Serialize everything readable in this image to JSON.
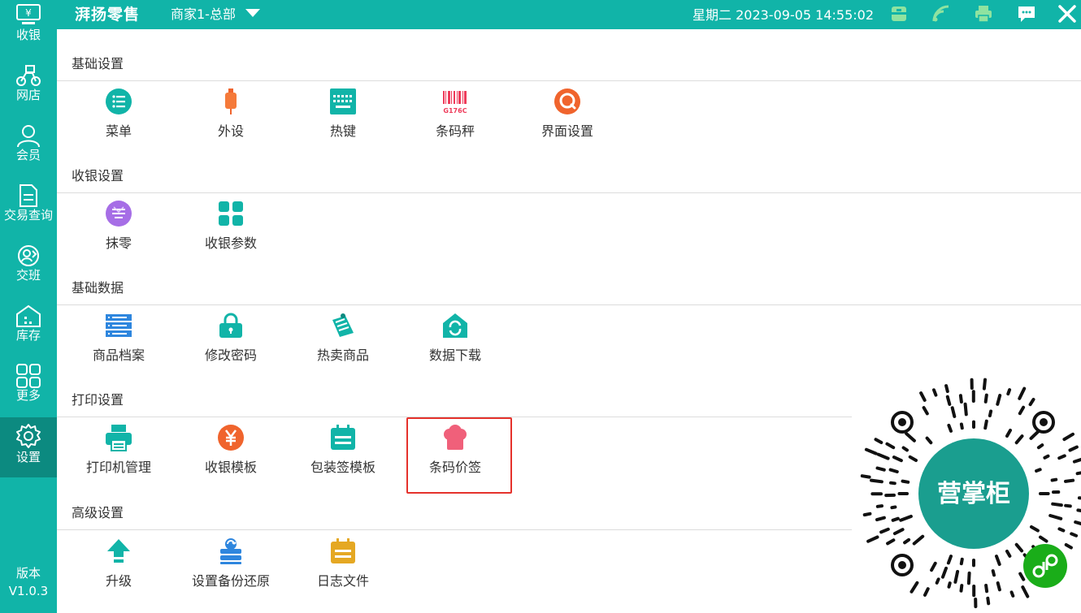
{
  "header": {
    "brand": "湃扬零售",
    "store": "商家1-总部",
    "datetime": "星期二 2023-09-05 14:55:02"
  },
  "sidebar": {
    "items": [
      {
        "label": "收银",
        "icon": "cash-register-icon"
      },
      {
        "label": "网店",
        "icon": "delivery-bike-icon"
      },
      {
        "label": "会员",
        "icon": "member-icon"
      },
      {
        "label": "交易查询",
        "icon": "document-icon"
      },
      {
        "label": "交班",
        "icon": "shift-handover-icon"
      },
      {
        "label": "库存",
        "icon": "warehouse-icon"
      },
      {
        "label": "更多",
        "icon": "grid-more-icon"
      },
      {
        "label": "设置",
        "icon": "gear-icon",
        "active": true
      }
    ],
    "version_label": "版本",
    "version": "V1.0.3"
  },
  "sections": [
    {
      "title": "基础设置",
      "items": [
        {
          "label": "菜单",
          "icon": "menu-list-icon"
        },
        {
          "label": "外设",
          "icon": "usb-device-icon"
        },
        {
          "label": "热键",
          "icon": "keyboard-icon"
        },
        {
          "label": "条码秤",
          "icon": "barcode-scale-icon",
          "icon_text": "G176C"
        },
        {
          "label": "界面设置",
          "icon": "interface-search-icon"
        }
      ]
    },
    {
      "title": "收银设置",
      "items": [
        {
          "label": "抹零",
          "icon": "round-off-icon"
        },
        {
          "label": "收银参数",
          "icon": "grid-params-icon"
        }
      ]
    },
    {
      "title": "基础数据",
      "items": [
        {
          "label": "商品档案",
          "icon": "server-list-icon"
        },
        {
          "label": "修改密码",
          "icon": "lock-icon"
        },
        {
          "label": "热卖商品",
          "icon": "hot-products-icon"
        },
        {
          "label": "数据下载",
          "icon": "data-download-icon"
        }
      ]
    },
    {
      "title": "打印设置",
      "items": [
        {
          "label": "打印机管理",
          "icon": "printer-icon"
        },
        {
          "label": "收银模板",
          "icon": "yen-icon"
        },
        {
          "label": "包装签模板",
          "icon": "calendar-icon"
        },
        {
          "label": "条码价签",
          "icon": "chef-hat-icon"
        }
      ]
    },
    {
      "title": "高级设置",
      "items": [
        {
          "label": "升级",
          "icon": "upgrade-arrow-icon"
        },
        {
          "label": "设置备份还原",
          "icon": "backup-restore-icon"
        },
        {
          "label": "日志文件",
          "icon": "log-file-icon"
        }
      ]
    }
  ],
  "qr": {
    "center_text": "营掌柜"
  },
  "colors": {
    "primary": "#11b4a8",
    "active": "#0c8a80",
    "highlight": "#e5322c",
    "wechat_green": "#1aad19"
  }
}
